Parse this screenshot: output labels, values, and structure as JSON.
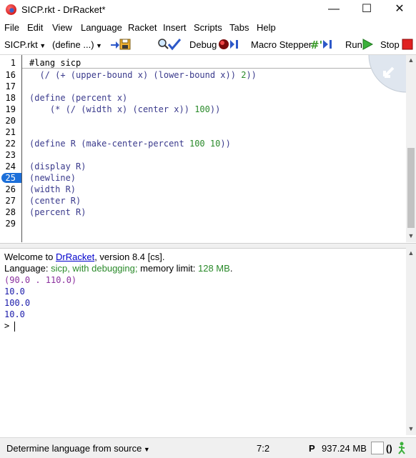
{
  "window": {
    "title": "SICP.rkt - DrRacket*",
    "minimize_glyph": "—",
    "maximize_glyph": "☐",
    "close_glyph": "✕"
  },
  "menu": {
    "file": "File",
    "edit": "Edit",
    "view": "View",
    "language": "Language",
    "racket": "Racket",
    "insert": "Insert",
    "scripts": "Scripts",
    "tabs": "Tabs",
    "help": "Help"
  },
  "toolbar": {
    "file_name": "SICP.rkt",
    "define_menu": "(define ...)",
    "debug": "Debug",
    "macro_stepper": "Macro Stepper",
    "run": "Run",
    "stop": "Stop"
  },
  "editor": {
    "first_line": {
      "number": "1",
      "text": "#lang sicp"
    },
    "lines": [
      {
        "number": "16",
        "text": "  (/ (+ (upper-bound x) (lower-bound x)) 2))"
      },
      {
        "number": "17",
        "text": ""
      },
      {
        "number": "18",
        "text": "(define (percent x)"
      },
      {
        "number": "19",
        "text": "    (* (/ (width x) (center x)) 100))"
      },
      {
        "number": "20",
        "text": ""
      },
      {
        "number": "21",
        "text": ""
      },
      {
        "number": "22",
        "text": "(define R (make-center-percent 100 10))"
      },
      {
        "number": "23",
        "text": ""
      },
      {
        "number": "24",
        "text": "(display R)"
      },
      {
        "number": "25",
        "text": "(newline)"
      },
      {
        "number": "26",
        "text": "(width R)"
      },
      {
        "number": "27",
        "text": "(center R)"
      },
      {
        "number": "28",
        "text": "(percent R)"
      },
      {
        "number": "29",
        "text": ""
      }
    ],
    "breakpoint_line": "25"
  },
  "repl": {
    "welcome_prefix": "Welcome to ",
    "welcome_link": "DrRacket",
    "welcome_suffix": ", version 8.4 [cs].",
    "language_prefix": "Language: ",
    "language_name": "sicp, with debugging;",
    "memory_text": " memory limit: ",
    "memory_value": "128 MB",
    "memory_end": ".",
    "outputs": [
      "(90.0 . 110.0)",
      "10.0",
      "100.0",
      "10.0"
    ],
    "prompt": ">"
  },
  "status": {
    "language_selector": "Determine language from source",
    "position": "7:2",
    "memory_badge": "P",
    "memory": "937.24 MB",
    "parens": "()"
  },
  "colors": {
    "code": "#3a3a8c",
    "number": "#2a8a2a",
    "breakpoint": "#1c6fd9",
    "output_pair": "#8a2f9e",
    "output_number": "#1a1aaa"
  }
}
